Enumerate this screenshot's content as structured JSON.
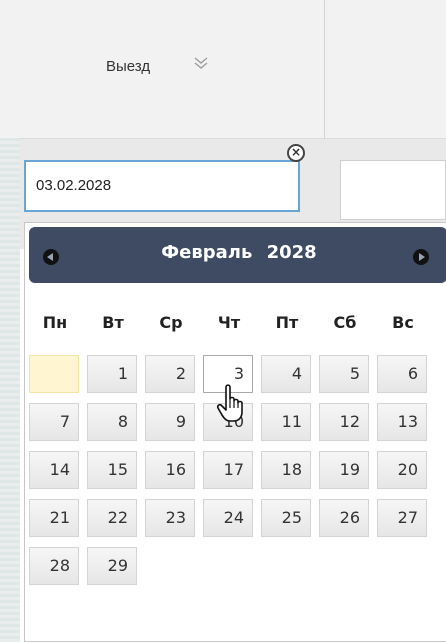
{
  "header": {
    "column_label": "Выезд",
    "sort_icon": "chevron-double-down-icon"
  },
  "checkout_input": {
    "value": "03.02.2028",
    "clear_icon": "close-circle-icon"
  },
  "datepicker": {
    "month": "Февраль",
    "year": "2028",
    "prev_icon": "prev-month-icon",
    "next_icon": "next-month-icon",
    "weekdays": [
      "Пн",
      "Вт",
      "Ср",
      "Чт",
      "Пт",
      "Сб",
      "Вс"
    ],
    "weeks": [
      [
        "",
        "1",
        "2",
        "3",
        "4",
        "5",
        "6"
      ],
      [
        "7",
        "8",
        "9",
        "10",
        "11",
        "12",
        "13"
      ],
      [
        "14",
        "15",
        "16",
        "17",
        "18",
        "19",
        "20"
      ],
      [
        "21",
        "22",
        "23",
        "24",
        "25",
        "26",
        "27"
      ],
      [
        "28",
        "29"
      ]
    ],
    "selected_day": "3"
  },
  "cursor_icon": "hand-pointer-icon"
}
